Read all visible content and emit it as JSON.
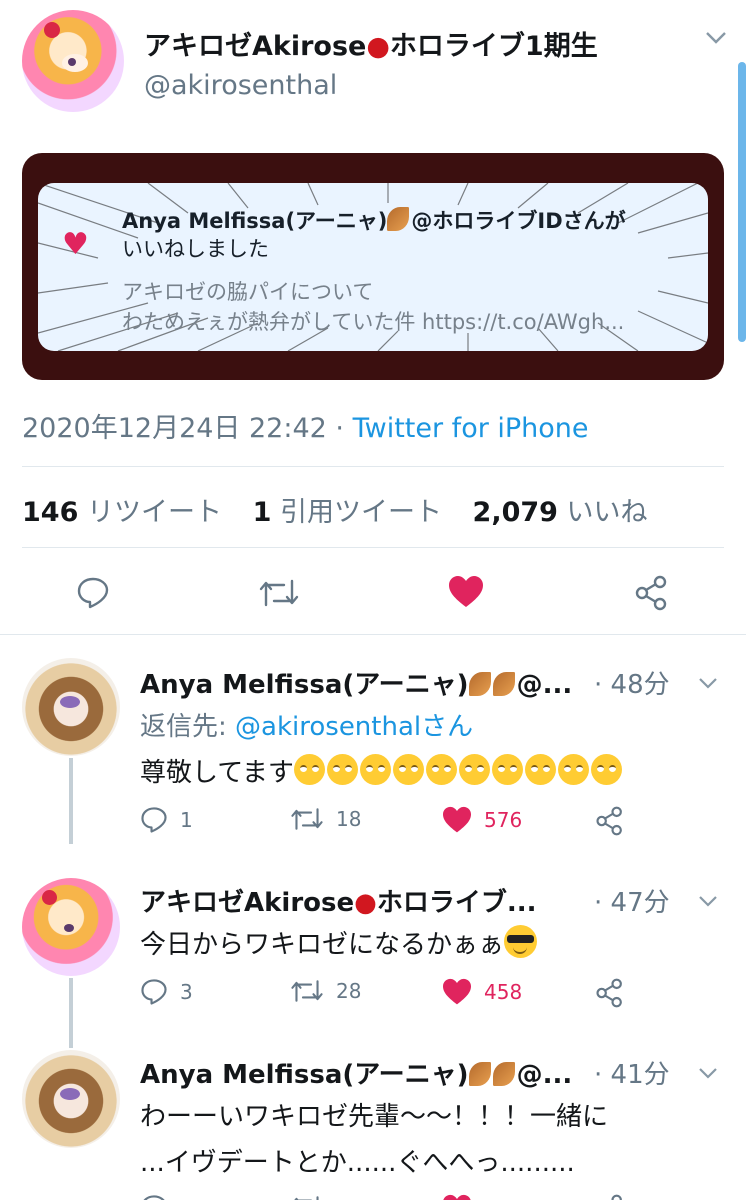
{
  "main_tweet": {
    "author_name_a": "アキロゼAkirose",
    "author_name_b": "ホロライブ1期生",
    "author_handle": "@akirosenthal",
    "image": {
      "line1_name": "Anya Melfissa(アーニャ)",
      "line1_suffix": "@ホロライブIDさんが",
      "line2": "いいねしました",
      "line3": "アキロゼの脇パイについて",
      "line4": "わためえぇが熱弁がしていた件 https://t.co/AWgh..."
    },
    "date": "2020年12月24日 22:42",
    "separator": "·",
    "source": "Twitter for iPhone",
    "stats": {
      "retweets_count": "146",
      "retweets_label": "リツイート",
      "quotes_count": "1",
      "quotes_label": "引用ツイート",
      "likes_count": "2,079",
      "likes_label": "いいね"
    }
  },
  "replies": [
    {
      "name": "Anya Melfissa(アーニャ)",
      "name_suffix": "@...",
      "time": "· 48分",
      "reply_label": "返信先:",
      "reply_mention": "@akirosenthalさん",
      "text": "尊敬してます",
      "emoji_count": 10,
      "replies": "1",
      "retweets": "18",
      "likes": "576"
    },
    {
      "name": "アキロゼAkirose",
      "name_suffix": "ホロライブ...",
      "time": "· 47分",
      "text": "今日からワキロゼになるかぁぁ",
      "replies": "3",
      "retweets": "28",
      "likes": "458"
    },
    {
      "name": "Anya Melfissa(アーニャ)",
      "name_suffix": "@...",
      "time": "· 41分",
      "text_line1": "わーーいワキロゼ先輩〜〜！！！一緒に",
      "text_line2": "...イヴデートとか......ぐへへっ.........",
      "replies": "",
      "retweets": "",
      "likes": ""
    }
  ],
  "icons": [
    "reply-icon",
    "retweet-icon",
    "like-icon",
    "share-icon",
    "chevron-down-icon",
    "apple-emoji",
    "leaf-emoji",
    "rolling-eyes-emoji",
    "sunglasses-emoji"
  ],
  "colors": {
    "accent": "#1b95e0",
    "like": "#e0245e",
    "muted": "#657786",
    "card_frame": "#3b0f0f"
  }
}
